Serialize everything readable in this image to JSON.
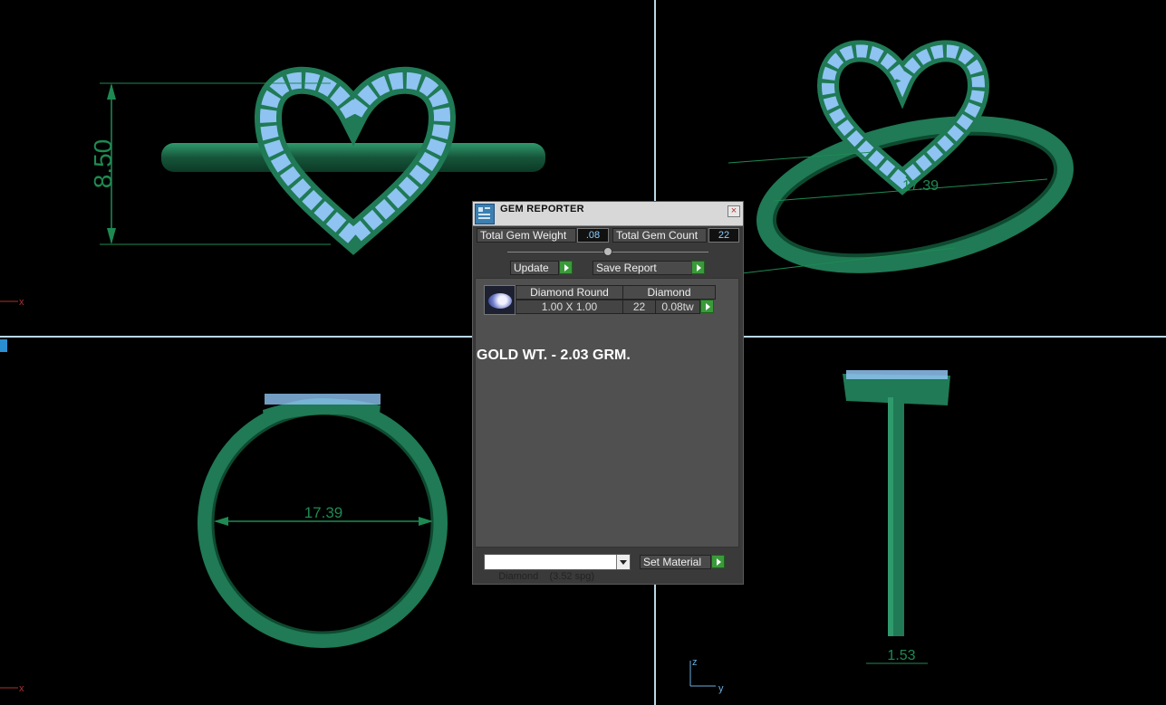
{
  "viewports": {
    "top_left": {
      "dimension_label": "8.50",
      "axis_label": "x"
    },
    "top_right": {
      "dimension_label": "17.39"
    },
    "bottom_left": {
      "dimension_label": "17.39",
      "axis_label": "x"
    },
    "bottom_right": {
      "dimension_label": "1.53",
      "axis_z": "z",
      "axis_y": "y"
    }
  },
  "gem_reporter": {
    "title": "GEM REPORTER",
    "close_symbol": "×",
    "total_gem_weight_label": "Total Gem Weight",
    "total_gem_weight_value": ".08",
    "total_gem_count_label": "Total Gem Count",
    "total_gem_count_value": "22",
    "update_label": "Update",
    "save_report_label": "Save Report",
    "table": {
      "headers": [
        "Diamond Round",
        "Diamond"
      ],
      "row": {
        "size": "1.00 X 1.00",
        "count": "22",
        "weight": "0.08tw"
      }
    },
    "annotation": "GOLD WT. - 2.03 GRM.",
    "material_select": "Diamond    (3.52 spg)",
    "set_material_label": "Set Material"
  },
  "colors": {
    "metal": "#1f7a55",
    "gems": "#8fc3f2",
    "dimension_lines": "#1e8a52",
    "background": "#000000",
    "viewport_divider": "#b8d8e8"
  }
}
